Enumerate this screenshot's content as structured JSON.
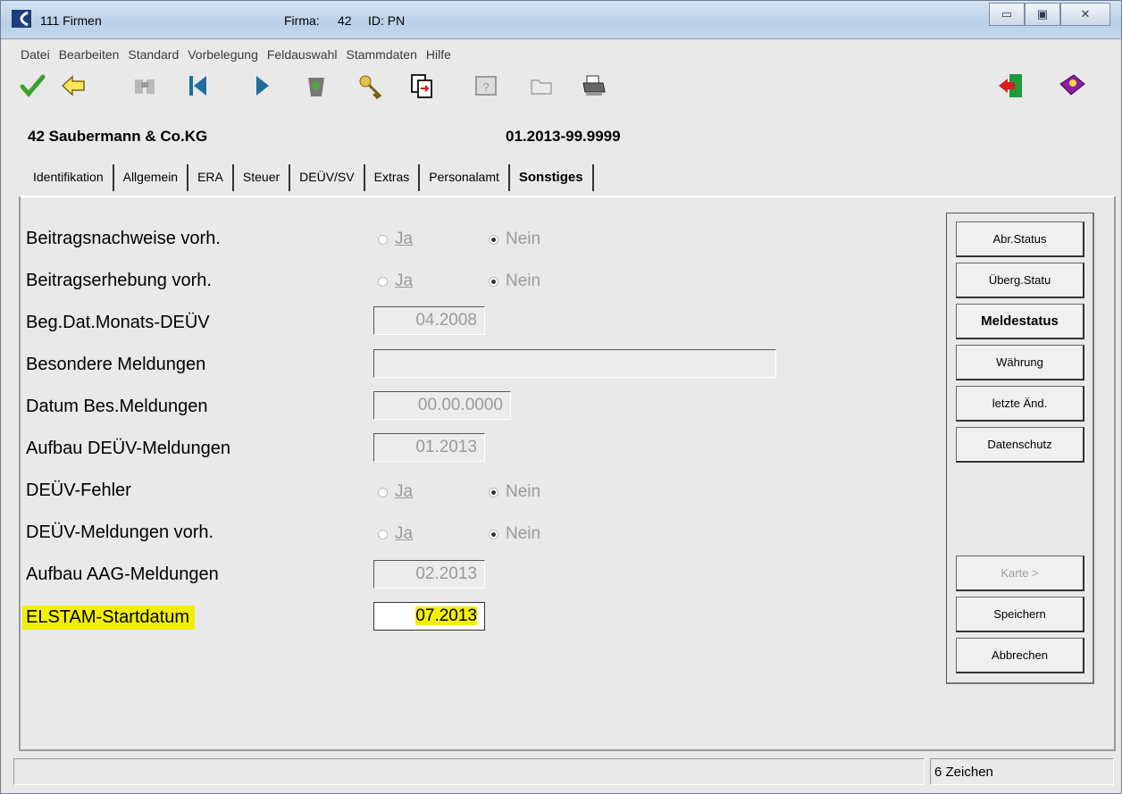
{
  "titlebar": {
    "app_title": "111 Firmen",
    "firma_label": "Firma:",
    "firma_value": "42",
    "id_label": "ID: PN"
  },
  "menu": [
    "Datei",
    "Bearbeiten",
    "Standard",
    "Vorbelegung",
    "Feldauswahl",
    "Stammdaten",
    "Hilfe"
  ],
  "toolbar": {
    "icons": [
      "check-icon",
      "back-arrow-icon",
      "binoculars-icon",
      "first-record-icon",
      "next-record-icon",
      "recycle-bin-icon",
      "key-icon",
      "copy-record-icon",
      "help-window-icon",
      "folder-icon",
      "printer-icon",
      "exit-door-icon",
      "help-book-icon"
    ]
  },
  "header": {
    "company": "42 Saubermann & Co.KG",
    "period": "01.2013-99.9999"
  },
  "tabs": [
    "Identifikation",
    "Allgemein",
    "ERA",
    "Steuer",
    "DEÜV/SV",
    "Extras",
    "Personalamt",
    "Sonstiges"
  ],
  "active_tab": "Sonstiges",
  "radio_options": {
    "yes": "Ja",
    "no": "Nein"
  },
  "rows": {
    "r1": {
      "label": "Beitragsnachweise vorh.",
      "selected": "Nein"
    },
    "r2": {
      "label": "Beitragserhebung vorh.",
      "selected": "Nein"
    },
    "r3": {
      "label": "Beg.Dat.Monats-DEÜV",
      "value": "04.2008"
    },
    "r4": {
      "label": "Besondere Meldungen",
      "value": ""
    },
    "r5": {
      "label": "Datum Bes.Meldungen",
      "value": "00.00.0000"
    },
    "r6": {
      "label": "Aufbau DEÜV-Meldungen",
      "value": "01.2013"
    },
    "r7": {
      "label": "DEÜV-Fehler",
      "selected": "Nein"
    },
    "r8": {
      "label": "DEÜV-Meldungen vorh.",
      "selected": "Nein"
    },
    "r9": {
      "label": "Aufbau AAG-Meldungen",
      "value": "02.2013"
    },
    "r10": {
      "label": "ELSTAM-Startdatum",
      "value": "07.2013"
    }
  },
  "side_buttons": {
    "abr_status": "Abr.Status",
    "uberg_status": "Überg.Statu",
    "meldestatus": "Meldestatus",
    "waehrung": "Währung",
    "letzte_aend": "letzte Änd.",
    "datenschutz": "Datenschutz",
    "karte": "Karte >",
    "speichern": "Speichern",
    "abbrechen": "Abbrechen"
  },
  "status": {
    "count": "6 Zeichen"
  },
  "colors": {
    "highlight": "#f2f000",
    "title_gradient": "#c7d9ec"
  }
}
